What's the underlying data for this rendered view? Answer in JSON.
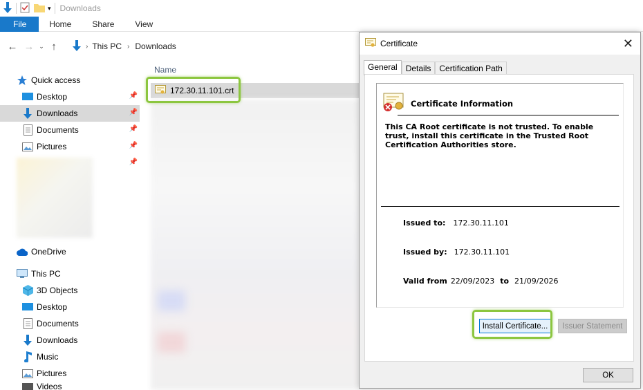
{
  "window": {
    "title": "Downloads"
  },
  "ribbon": {
    "tabs": [
      "File",
      "Home",
      "Share",
      "View"
    ]
  },
  "address": {
    "crumbs": [
      "This PC",
      "Downloads"
    ]
  },
  "sidebar": {
    "quick_access": "Quick access",
    "quick_items": [
      {
        "label": "Desktop",
        "icon": "desktop-icon"
      },
      {
        "label": "Downloads",
        "icon": "download-arrow-icon"
      },
      {
        "label": "Documents",
        "icon": "document-icon"
      },
      {
        "label": "Pictures",
        "icon": "pictures-icon"
      }
    ],
    "onedrive": "OneDrive",
    "this_pc": "This PC",
    "pc_items": [
      {
        "label": "3D Objects",
        "icon": "cube-icon"
      },
      {
        "label": "Desktop",
        "icon": "desktop-icon"
      },
      {
        "label": "Documents",
        "icon": "document-icon"
      },
      {
        "label": "Downloads",
        "icon": "download-arrow-icon"
      },
      {
        "label": "Music",
        "icon": "music-icon"
      },
      {
        "label": "Pictures",
        "icon": "pictures-icon"
      },
      {
        "label": "Videos",
        "icon": "video-icon"
      }
    ]
  },
  "files": {
    "column_name": "Name",
    "selected_file": "172.30.11.101.crt"
  },
  "dialog": {
    "title": "Certificate",
    "tabs": [
      "General",
      "Details",
      "Certification Path"
    ],
    "info_title": "Certificate Information",
    "message": "This CA Root certificate is not trusted. To enable trust, install this certificate in the Trusted Root Certification Authorities store.",
    "issued_to_label": "Issued to:",
    "issued_to": "172.30.11.101",
    "issued_by_label": "Issued by:",
    "issued_by": "172.30.11.101",
    "valid_from_label": "Valid from",
    "valid_from": "22/09/2023",
    "valid_to_label": "to",
    "valid_to": "21/09/2026",
    "install_button": "Install Certificate...",
    "issuer_statement_button": "Issuer Statement",
    "ok_button": "OK"
  },
  "colors": {
    "accent": "#1979ca",
    "highlight": "#8cc63f",
    "selection": "#cce8ff"
  }
}
